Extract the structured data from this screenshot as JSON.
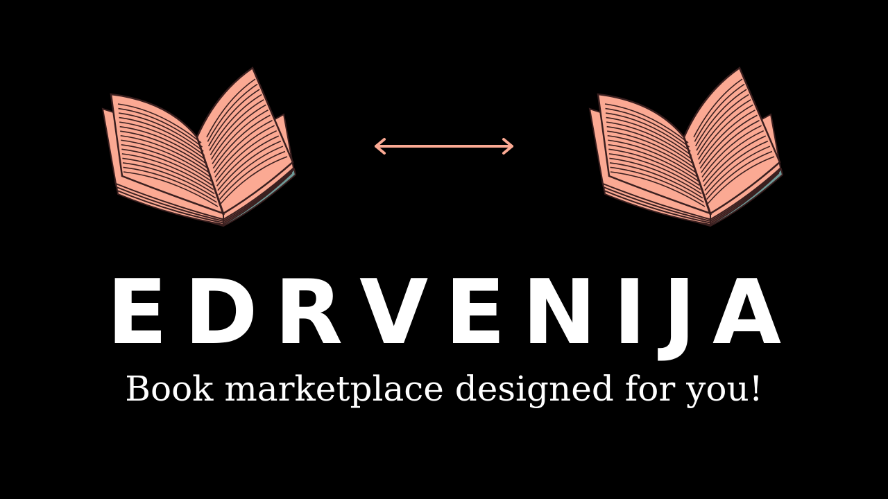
{
  "brand": {
    "name": "EDRVENIJA",
    "tagline": "Book marketplace designed for you!"
  },
  "colors": {
    "background": "#000000",
    "accent": "#FBA993",
    "outline": "#3A1F1F",
    "page_edge": "#6E9A98",
    "text": "#FFFFFF"
  },
  "icons": {
    "left": "open-book-icon",
    "center": "double-arrow-icon",
    "right": "open-book-icon"
  }
}
